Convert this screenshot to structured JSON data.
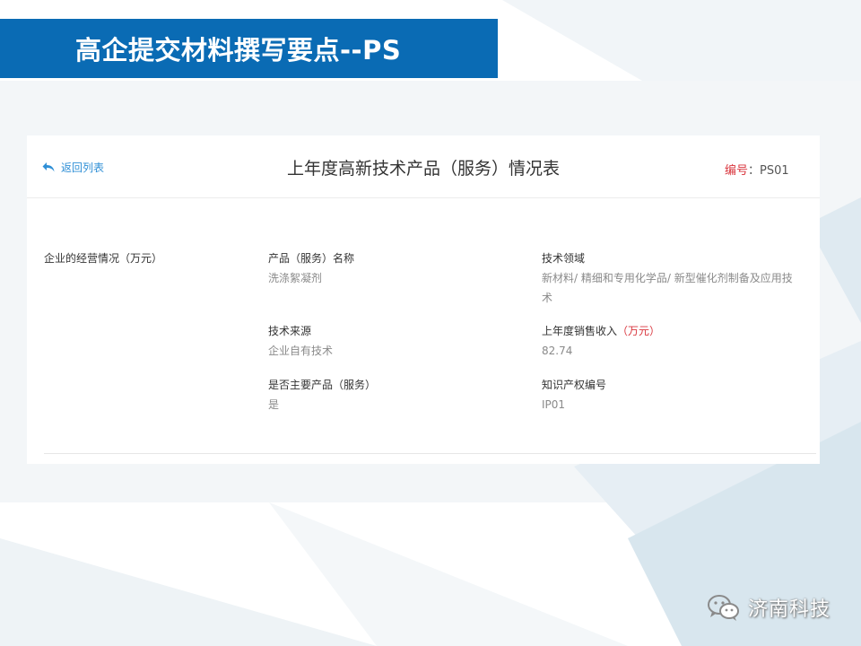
{
  "slide": {
    "title": "高企提交材料撰写要点--PS"
  },
  "card": {
    "back_label": "返回列表",
    "title": "上年度高新技术产品（服务）情况表",
    "code_label": "编号",
    "code_sep": "：",
    "code_value": "PS01",
    "section_label": "企业的经营情况（万元）",
    "fields": {
      "product_name": {
        "label": "产品（服务）名称",
        "value": "洗涤絮凝剂"
      },
      "tech_field": {
        "label": "技术领域",
        "value": "新材料/ 精细和专用化学品/ 新型催化剂制备及应用技术"
      },
      "tech_source": {
        "label": "技术来源",
        "value": "企业自有技术"
      },
      "sales_income": {
        "label": "上年度销售收入",
        "unit": "（万元）",
        "value": "82.74"
      },
      "is_main": {
        "label": "是否主要产品（服务）",
        "value": "是"
      },
      "ip_number": {
        "label": "知识产权编号",
        "value": "IP01"
      }
    }
  },
  "watermark": {
    "text": "济南科技"
  },
  "colors": {
    "banner": "#0a6bb4",
    "link": "#2f8fd6",
    "accent_red": "#d9363e",
    "deco_light": "#e3edf3"
  }
}
